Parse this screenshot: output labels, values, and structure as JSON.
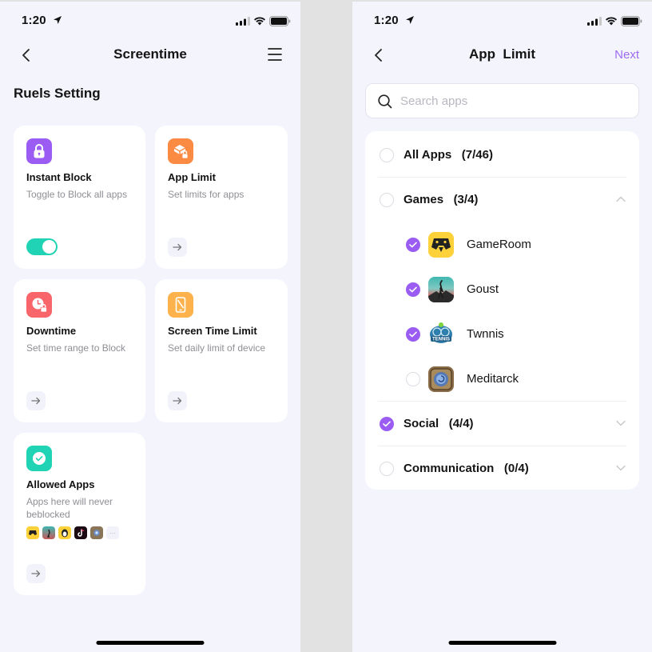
{
  "status_bar": {
    "time": "1:20"
  },
  "screen_left": {
    "nav": {
      "title": "Screentime"
    },
    "section_title": "Ruels Setting",
    "cards": [
      {
        "title": "Instant Block",
        "description": "Toggle to Block all apps",
        "icon": "lock-icon",
        "color": "#9a5cf2",
        "control": "toggle",
        "toggle_on": true
      },
      {
        "title": "App Limit",
        "description": "Set limits for apps",
        "icon": "box-lock-icon",
        "color": "#fb8a43",
        "control": "arrow"
      },
      {
        "title": "Downtime",
        "description": "Set time range to Block",
        "icon": "clock-lock-icon",
        "color": "#f8656a",
        "control": "arrow"
      },
      {
        "title": "Screen Time Limit",
        "description": "Set daily limit of device",
        "icon": "phone-slash-icon",
        "color": "#fdb24b",
        "control": "arrow"
      },
      {
        "title": "Allowed Apps",
        "description": "Apps here will never beblocked",
        "icon": "check-circle-icon",
        "color": "#1fd3b4",
        "control": "arrow",
        "app_previews": [
          "GameRoom",
          "Goust",
          "Penguin",
          "TikTok",
          "Meditarck"
        ],
        "more_label": "···"
      }
    ]
  },
  "screen_right": {
    "nav": {
      "title": "App  Limit",
      "next_label": "Next"
    },
    "search": {
      "placeholder": "Search apps",
      "value": ""
    },
    "list": [
      {
        "type": "group",
        "label": "All Apps",
        "count": "(7/46)",
        "checked": false
      },
      {
        "type": "group",
        "label": "Games",
        "count": "(3/4)",
        "checked": false,
        "expanded": true,
        "apps": [
          {
            "name": "GameRoom",
            "checked": true
          },
          {
            "name": "Goust",
            "checked": true
          },
          {
            "name": "Twnnis",
            "checked": true
          },
          {
            "name": "Meditarck",
            "checked": false
          }
        ]
      },
      {
        "type": "group",
        "label": "Social",
        "count": "(4/4)",
        "checked": true,
        "expanded": false
      },
      {
        "type": "group",
        "label": "Communication",
        "count": "(0/4)",
        "checked": false,
        "expanded": false
      }
    ]
  },
  "colors": {
    "accent": "#9a5cf2",
    "toggle": "#1fd3b4",
    "background": "#f4f4fd"
  }
}
